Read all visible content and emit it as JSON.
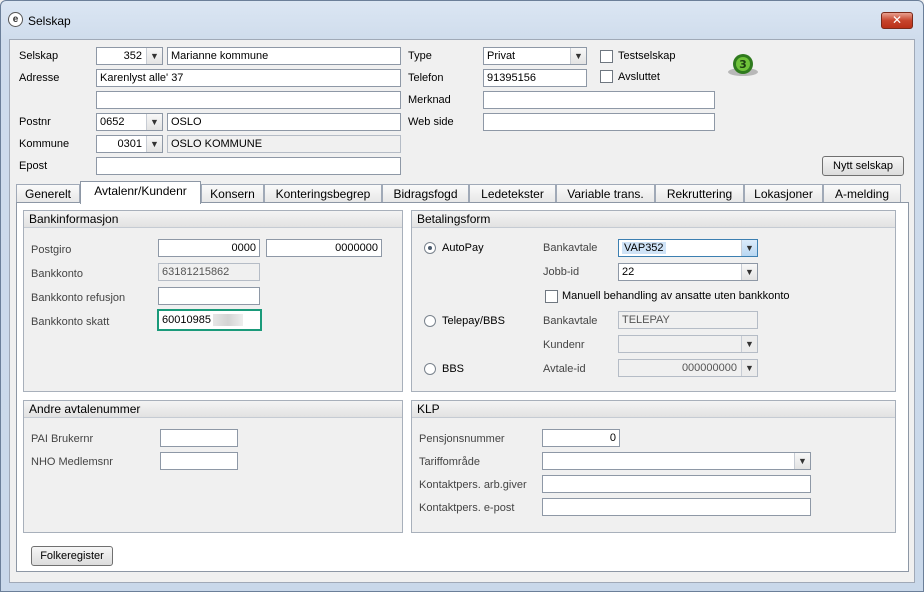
{
  "window": {
    "title": "Selskap",
    "close": "✕"
  },
  "header": {
    "selskap_label": "Selskap",
    "selskap_nr": "352",
    "selskap_navn": "Marianne kommune",
    "adresse_label": "Adresse",
    "adresse1": "Karenlyst alle' 37",
    "adresse2": "",
    "postnr_label": "Postnr",
    "postnr": "0652",
    "poststed": "OSLO",
    "kommune_label": "Kommune",
    "kommune_nr": "0301",
    "kommune_navn": "OSLO KOMMUNE",
    "epost_label": "Epost",
    "epost": "",
    "type_label": "Type",
    "type": "Privat",
    "telefon_label": "Telefon",
    "telefon": "91395156",
    "merknad_label": "Merknad",
    "merknad": "",
    "webside_label": "Web side",
    "webside": "",
    "testselskap_label": "Testselskap",
    "avsluttet_label": "Avsluttet",
    "nytt_selskap_label": "Nytt selskap"
  },
  "tabs": [
    {
      "label": "Generelt"
    },
    {
      "label": "Avtalenr/Kundenr"
    },
    {
      "label": "Konsern"
    },
    {
      "label": "Konteringsbegrep"
    },
    {
      "label": "Bidragsfogd"
    },
    {
      "label": "Ledetekster"
    },
    {
      "label": "Variable trans."
    },
    {
      "label": "Rekruttering"
    },
    {
      "label": "Lokasjoner"
    },
    {
      "label": "A-melding"
    }
  ],
  "bankinfo": {
    "title": "Bankinformasjon",
    "postgiro_label": "Postgiro",
    "postgiro1": "0000",
    "postgiro2": "0000000",
    "bankkonto_label": "Bankkonto",
    "bankkonto": "63181215862",
    "refusjon_label": "Bankkonto refusjon",
    "refusjon": "",
    "skatt_label": "Bankkonto skatt",
    "skatt": "60010985"
  },
  "betalingsform": {
    "title": "Betalingsform",
    "autopay_label": "AutoPay",
    "bankavtale_label": "Bankavtale",
    "bankavtale": "VAP352",
    "jobbid_label": "Jobb-id",
    "jobbid": "22",
    "manuell_label": "Manuell behandling av ansatte uten bankkonto",
    "telepay_label": "Telepay/BBS",
    "telepay_bankavtale_label": "Bankavtale",
    "telepay_bankavtale": "TELEPAY",
    "kundenr_label": "Kundenr",
    "kundenr": "",
    "bbs_label": "BBS",
    "avtaleid_label": "Avtale-id",
    "avtaleid": "000000000"
  },
  "andre": {
    "title": "Andre avtalenummer",
    "pai_label": "PAI Brukernr",
    "pai": "",
    "nho_label": "NHO Medlemsnr",
    "nho": ""
  },
  "klp": {
    "title": "KLP",
    "pensjon_label": "Pensjonsnummer",
    "pensjon": "0",
    "tariff_label": "Tariffområde",
    "tariff": "",
    "arbgiver_label": "Kontaktpers. arb.giver",
    "arbgiver": "",
    "epost_label": "Kontaktpers. e-post",
    "epost": ""
  },
  "footer": {
    "folkeregister_label": "Folkeregister"
  },
  "icons": {
    "app": "app-logo-icon",
    "dropdown": "chevron-down-icon",
    "close": "close-icon"
  },
  "colors": {
    "focus_border": "#1a9a7a",
    "close_button": "#c7452d",
    "window_frame": "#cfdcec"
  }
}
